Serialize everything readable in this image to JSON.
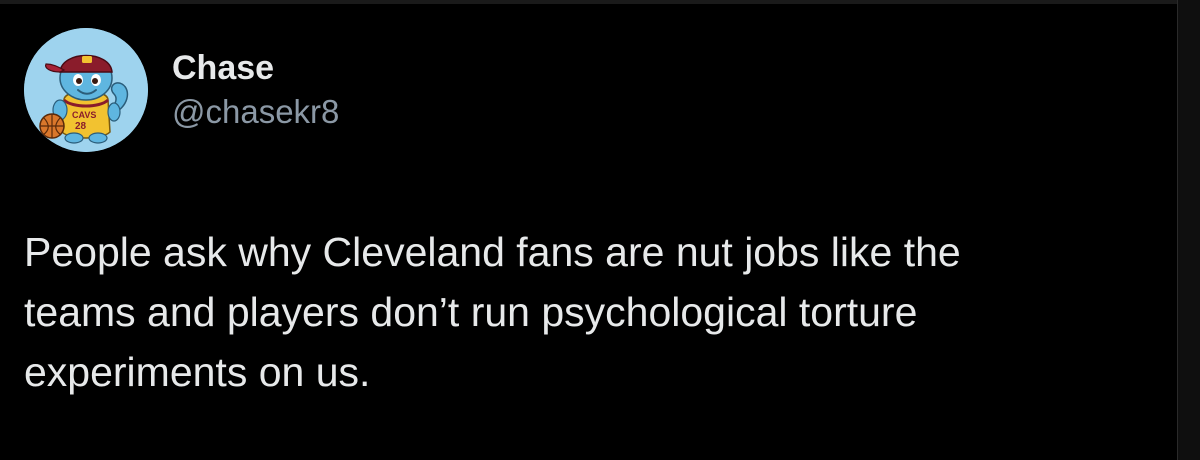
{
  "tweet": {
    "author": {
      "display_name": "Chase",
      "handle": "@chasekr8",
      "avatar_jersey_text": "CAVS",
      "avatar_jersey_number": "28"
    },
    "text": "People ask why Cleveland fans are nut jobs like the\nteams and players don’t run psychological torture\nexperiments on us."
  },
  "colors": {
    "background": "#000000",
    "text_primary": "#e7e9ea",
    "text_secondary": "#8b98a5",
    "avatar_bg": "#9ed3ee"
  }
}
